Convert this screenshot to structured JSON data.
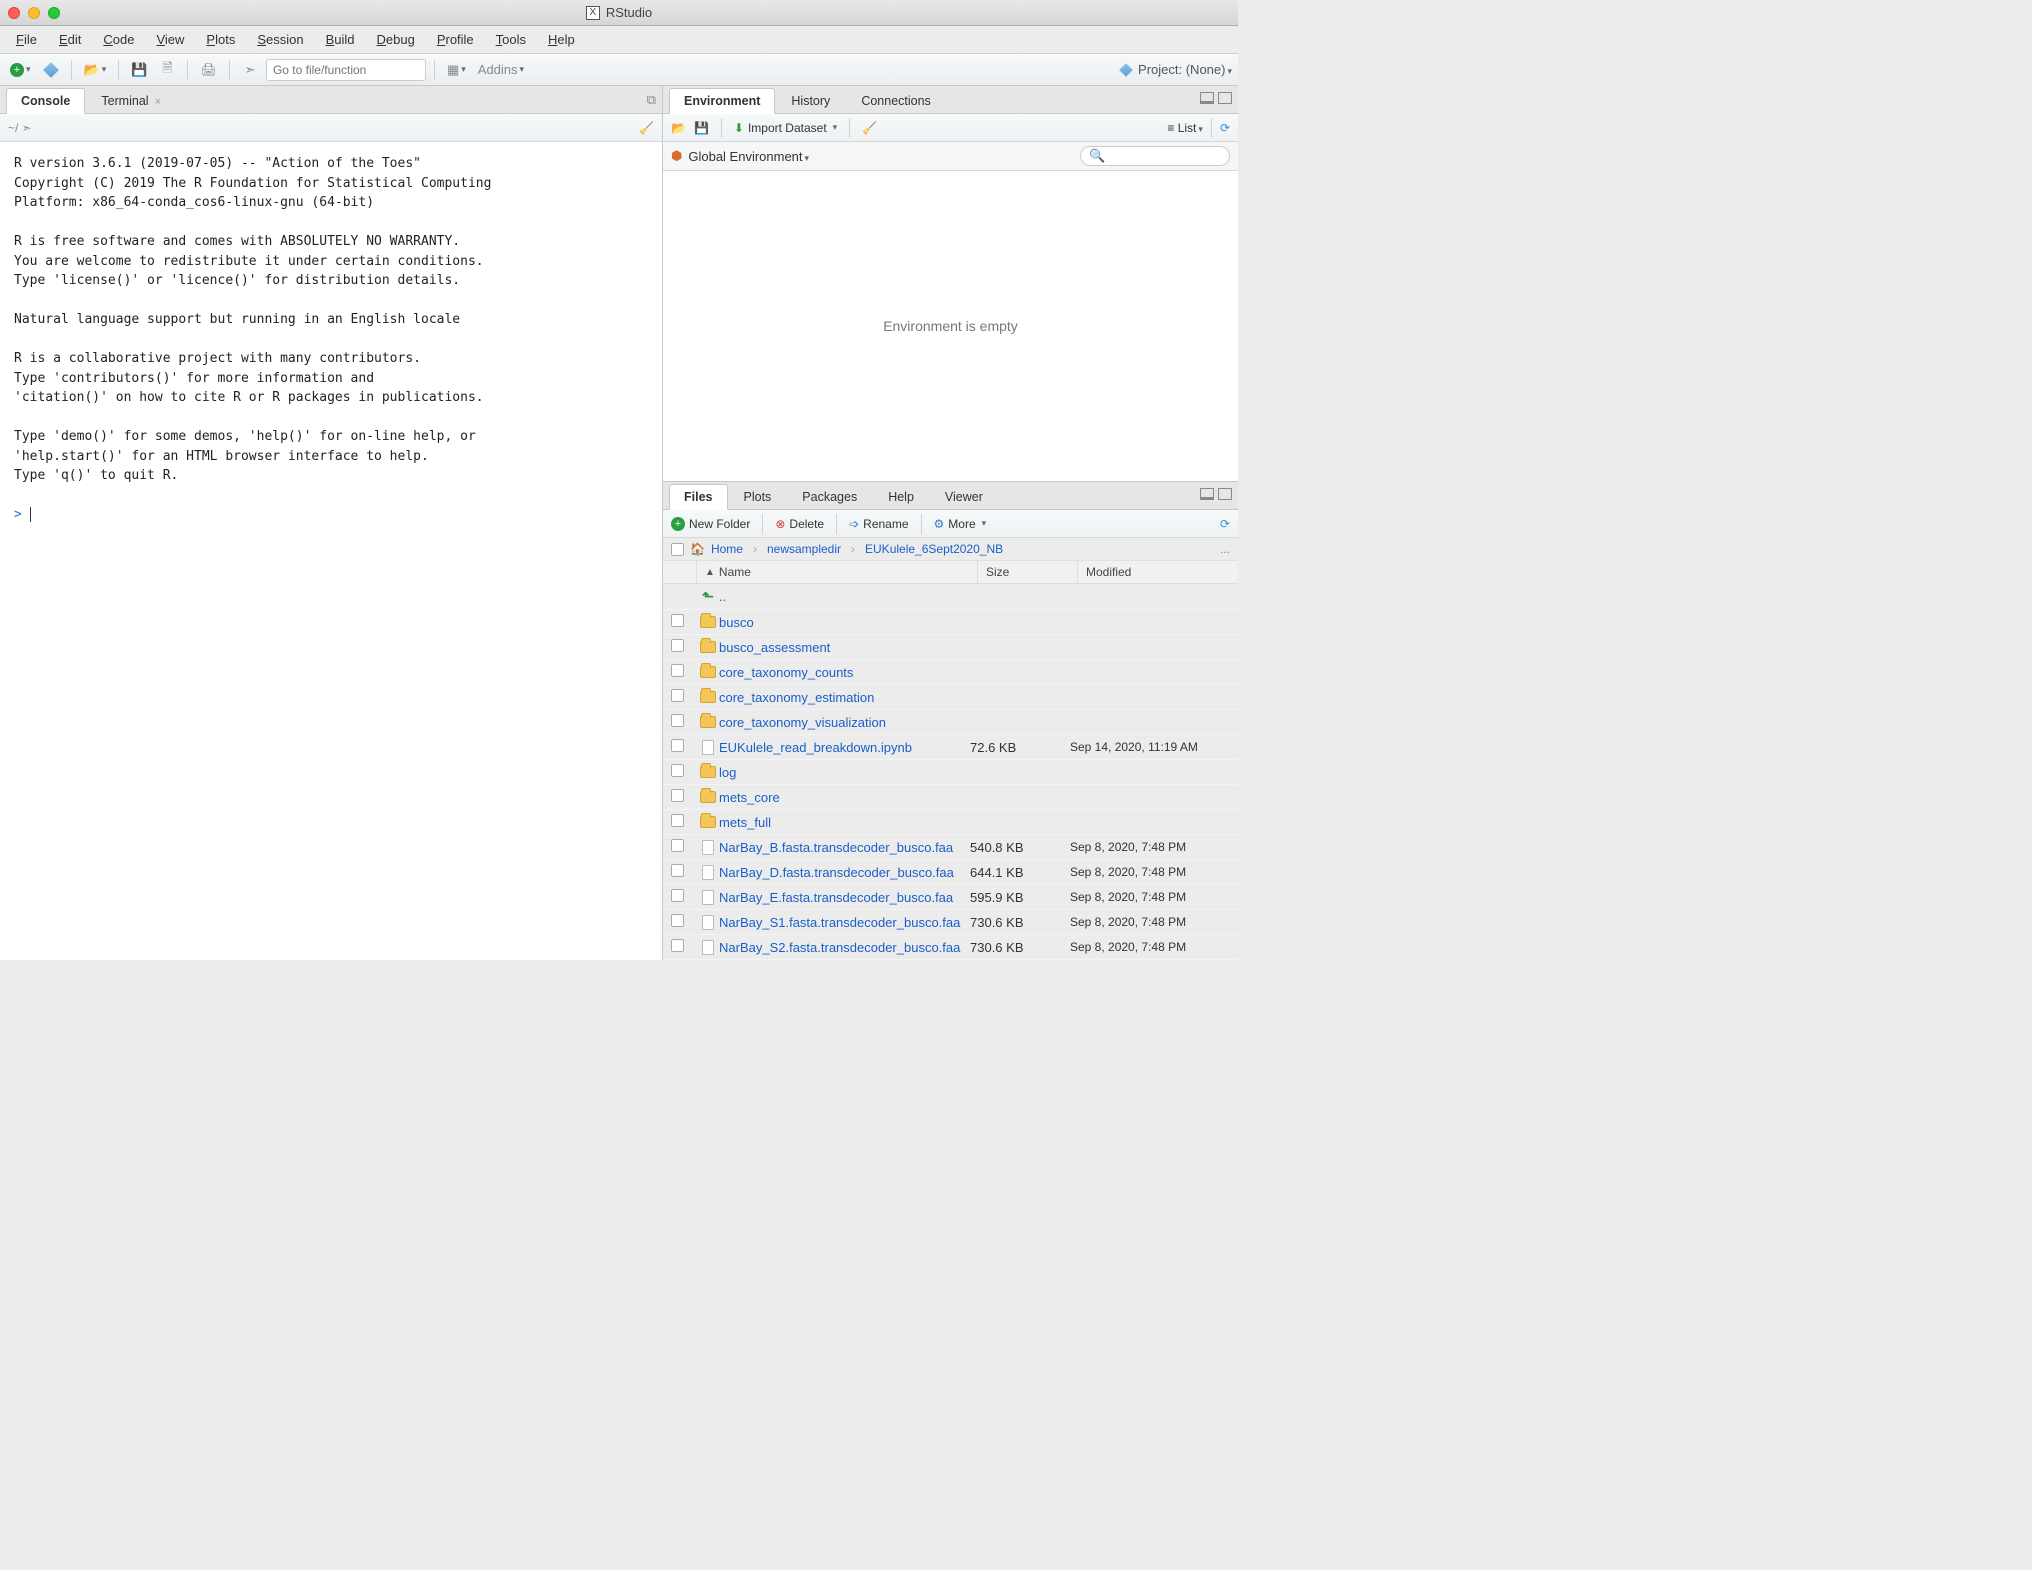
{
  "window": {
    "title": "RStudio"
  },
  "menu": [
    "File",
    "Edit",
    "Code",
    "View",
    "Plots",
    "Session",
    "Build",
    "Debug",
    "Profile",
    "Tools",
    "Help"
  ],
  "toolbar": {
    "goto_placeholder": "Go to file/function",
    "addins": "Addins",
    "project_label": "Project: (None)"
  },
  "left": {
    "tabs": [
      "Console",
      "Terminal"
    ],
    "active": 0,
    "console_lines": [
      "R version 3.6.1 (2019-07-05) -- \"Action of the Toes\"",
      "Copyright (C) 2019 The R Foundation for Statistical Computing",
      "Platform: x86_64-conda_cos6-linux-gnu (64-bit)",
      "",
      "R is free software and comes with ABSOLUTELY NO WARRANTY.",
      "You are welcome to redistribute it under certain conditions.",
      "Type 'license()' or 'licence()' for distribution details.",
      "",
      "  Natural language support but running in an English locale",
      "",
      "R is a collaborative project with many contributors.",
      "Type 'contributors()' for more information and",
      "'citation()' on how to cite R or R packages in publications.",
      "",
      "Type 'demo()' for some demos, 'help()' for on-line help, or",
      "'help.start()' for an HTML browser interface to help.",
      "Type 'q()' to quit R.",
      ""
    ],
    "prompt": ">"
  },
  "env": {
    "tabs": [
      "Environment",
      "History",
      "Connections"
    ],
    "active": 0,
    "import_label": "Import Dataset",
    "view_label": "List",
    "scope": "Global Environment",
    "empty_msg": "Environment is empty"
  },
  "files": {
    "tabs": [
      "Files",
      "Plots",
      "Packages",
      "Help",
      "Viewer"
    ],
    "active": 0,
    "toolbar": {
      "new_folder": "New Folder",
      "delete": "Delete",
      "rename": "Rename",
      "more": "More"
    },
    "breadcrumb": [
      "Home",
      "newsampledir",
      "EUKulele_6Sept2020_NB"
    ],
    "headers": {
      "name": "Name",
      "size": "Size",
      "modified": "Modified"
    },
    "up": "..",
    "rows": [
      {
        "type": "folder",
        "name": "busco",
        "size": "",
        "mod": ""
      },
      {
        "type": "folder",
        "name": "busco_assessment",
        "size": "",
        "mod": ""
      },
      {
        "type": "folder",
        "name": "core_taxonomy_counts",
        "size": "",
        "mod": ""
      },
      {
        "type": "folder",
        "name": "core_taxonomy_estimation",
        "size": "",
        "mod": ""
      },
      {
        "type": "folder",
        "name": "core_taxonomy_visualization",
        "size": "",
        "mod": ""
      },
      {
        "type": "file",
        "name": "EUKulele_read_breakdown.ipynb",
        "size": "72.6 KB",
        "mod": "Sep 14, 2020, 11:19 AM"
      },
      {
        "type": "folder",
        "name": "log",
        "size": "",
        "mod": ""
      },
      {
        "type": "folder",
        "name": "mets_core",
        "size": "",
        "mod": ""
      },
      {
        "type": "folder",
        "name": "mets_full",
        "size": "",
        "mod": ""
      },
      {
        "type": "file",
        "name": "NarBay_B.fasta.transdecoder_busco.faa",
        "size": "540.8 KB",
        "mod": "Sep 8, 2020, 7:48 PM"
      },
      {
        "type": "file",
        "name": "NarBay_D.fasta.transdecoder_busco.faa",
        "size": "644.1 KB",
        "mod": "Sep 8, 2020, 7:48 PM"
      },
      {
        "type": "file",
        "name": "NarBay_E.fasta.transdecoder_busco.faa",
        "size": "595.9 KB",
        "mod": "Sep 8, 2020, 7:48 PM"
      },
      {
        "type": "file",
        "name": "NarBay_S1.fasta.transdecoder_busco.faa",
        "size": "730.6 KB",
        "mod": "Sep 8, 2020, 7:48 PM"
      },
      {
        "type": "file",
        "name": "NarBay_S2.fasta.transdecoder_busco.faa",
        "size": "730.6 KB",
        "mod": "Sep 8, 2020, 7:48 PM"
      }
    ]
  }
}
